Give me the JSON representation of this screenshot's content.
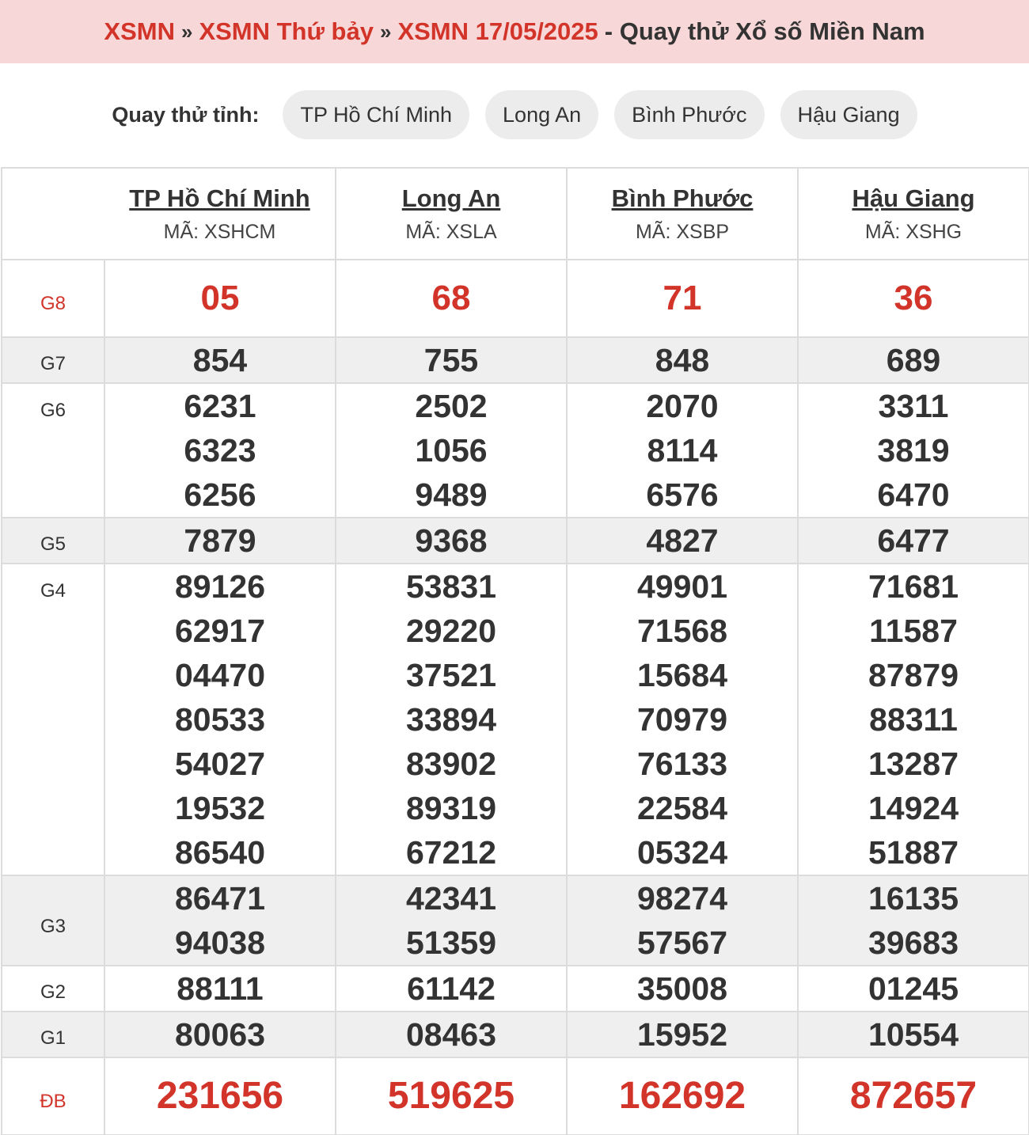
{
  "breadcrumb": {
    "item1": "XSMN",
    "item2": "XSMN Thứ bảy",
    "item3": "XSMN 17/05/2025",
    "tail": "- Quay thử Xổ số Miền Nam",
    "separator": "»"
  },
  "quick_bar": {
    "label": "Quay thử tỉnh:",
    "chips": [
      "TP Hồ Chí Minh",
      "Long An",
      "Bình Phước",
      "Hậu Giang"
    ]
  },
  "provinces": [
    {
      "name": "TP Hồ Chí Minh",
      "code": "MÃ: XSHCM"
    },
    {
      "name": "Long An",
      "code": "MÃ: XSLA"
    },
    {
      "name": "Bình Phước",
      "code": "MÃ: XSBP"
    },
    {
      "name": "Hậu Giang",
      "code": "MÃ: XSHG"
    }
  ],
  "prizes": [
    {
      "label": "G8",
      "numbers": [
        [
          "05"
        ],
        [
          "68"
        ],
        [
          "71"
        ],
        [
          "36"
        ]
      ]
    },
    {
      "label": "G7",
      "numbers": [
        [
          "854"
        ],
        [
          "755"
        ],
        [
          "848"
        ],
        [
          "689"
        ]
      ]
    },
    {
      "label": "G6",
      "numbers": [
        [
          "6231",
          "6323",
          "6256"
        ],
        [
          "2502",
          "1056",
          "9489"
        ],
        [
          "2070",
          "8114",
          "6576"
        ],
        [
          "3311",
          "3819",
          "6470"
        ]
      ]
    },
    {
      "label": "G5",
      "numbers": [
        [
          "7879"
        ],
        [
          "9368"
        ],
        [
          "4827"
        ],
        [
          "6477"
        ]
      ]
    },
    {
      "label": "G4",
      "numbers": [
        [
          "89126",
          "62917",
          "04470",
          "80533",
          "54027",
          "19532",
          "86540"
        ],
        [
          "53831",
          "29220",
          "37521",
          "33894",
          "83902",
          "89319",
          "67212"
        ],
        [
          "49901",
          "71568",
          "15684",
          "70979",
          "76133",
          "22584",
          "05324"
        ],
        [
          "71681",
          "11587",
          "87879",
          "88311",
          "13287",
          "14924",
          "51887"
        ]
      ]
    },
    {
      "label": "G3",
      "numbers": [
        [
          "86471",
          "94038"
        ],
        [
          "42341",
          "51359"
        ],
        [
          "98274",
          "57567"
        ],
        [
          "16135",
          "39683"
        ]
      ]
    },
    {
      "label": "G2",
      "numbers": [
        [
          "88111"
        ],
        [
          "61142"
        ],
        [
          "35008"
        ],
        [
          "01245"
        ]
      ]
    },
    {
      "label": "G1",
      "numbers": [
        [
          "80063"
        ],
        [
          "08463"
        ],
        [
          "15952"
        ],
        [
          "10554"
        ]
      ]
    },
    {
      "label": "ĐB",
      "numbers": [
        [
          "231656"
        ],
        [
          "519625"
        ],
        [
          "162692"
        ],
        [
          "872657"
        ]
      ]
    }
  ]
}
